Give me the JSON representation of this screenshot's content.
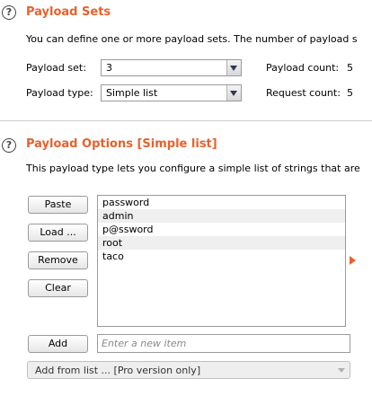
{
  "payload_sets": {
    "title": "Payload Sets",
    "description": "You can define one or more payload sets. The number of payload s",
    "set_label": "Payload set:",
    "set_value": "3",
    "type_label": "Payload type:",
    "type_value": "Simple list",
    "count_label": "Payload count:",
    "count_value": "5",
    "request_label": "Request count:",
    "request_value": "5"
  },
  "payload_options": {
    "title": "Payload Options [Simple list]",
    "description": "This payload type lets you configure a simple list of strings that are",
    "buttons": {
      "paste": "Paste",
      "load": "Load ...",
      "remove": "Remove",
      "clear": "Clear",
      "add": "Add"
    },
    "items": [
      "password",
      "admin",
      "p@ssword",
      "root",
      "taco"
    ],
    "new_item_placeholder": "Enter a new item",
    "add_from_list": "Add from list ... [Pro version only]"
  },
  "colors": {
    "accent": "#e8612c"
  }
}
